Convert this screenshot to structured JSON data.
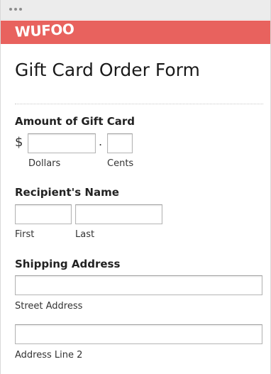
{
  "brand": {
    "logo_text": "WUFOO",
    "bar_color": "#e8625e"
  },
  "form": {
    "title": "Gift Card Order Form",
    "amount": {
      "label": "Amount of Gift Card",
      "currency_symbol": "$",
      "separator": ".",
      "dollars_value": "",
      "dollars_label": "Dollars",
      "cents_value": "",
      "cents_label": "Cents"
    },
    "recipient": {
      "label": "Recipient's Name",
      "first_value": "",
      "first_label": "First",
      "last_value": "",
      "last_label": "Last"
    },
    "shipping": {
      "label": "Shipping Address",
      "street_value": "",
      "street_label": "Street Address",
      "line2_value": "",
      "line2_label": "Address Line 2"
    }
  }
}
